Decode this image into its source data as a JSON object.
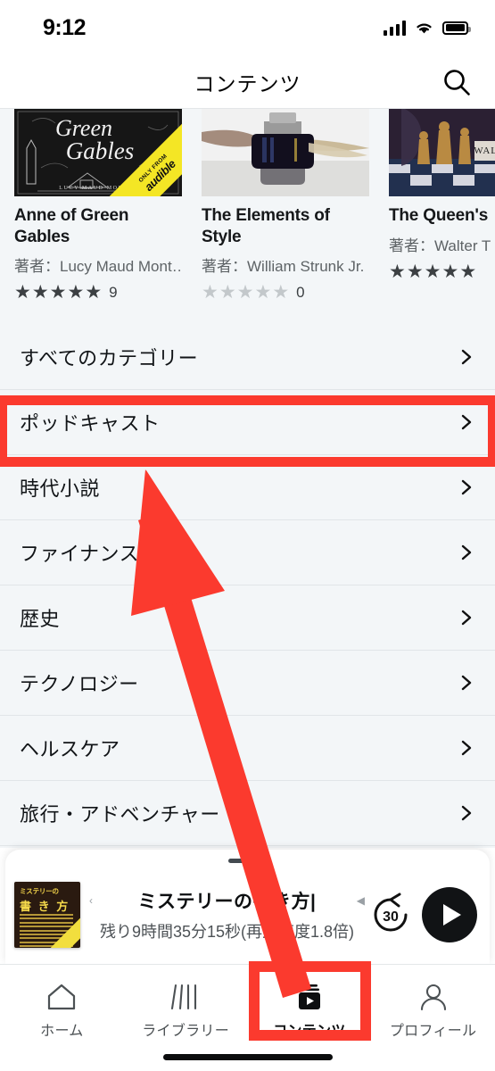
{
  "status_bar": {
    "time": "9:12",
    "icons": [
      "cellular-signal-icon",
      "wifi-icon",
      "battery-icon"
    ]
  },
  "header": {
    "title": "コンテンツ",
    "search_icon": "search-icon"
  },
  "carousel": {
    "books": [
      {
        "title": "Anne of Green Gables",
        "author": "著者：Lucy Maud Mont…",
        "rating_filled": 5,
        "rating_total": 5,
        "review_count": "9",
        "cover_text_line1": "Green",
        "cover_text_line2": "Gables",
        "cover_credit": "LUCY MAUD MONTG",
        "badge_small": "ONLY FROM",
        "badge_brand": "audible"
      },
      {
        "title": "The Elements of Style",
        "author": "著者：William Strunk Jr.",
        "rating_filled": 0,
        "rating_total": 5,
        "review_count": "0"
      },
      {
        "title": "The Queen's",
        "author": "著者：Walter T",
        "rating_filled": 5,
        "rating_total": 5,
        "review_count": "",
        "cover_text": "WALTER"
      }
    ]
  },
  "categories": [
    {
      "label": "すべてのカテゴリー",
      "chevron": "chevron-right-icon"
    },
    {
      "label": "ポッドキャスト",
      "chevron": "chevron-right-icon"
    },
    {
      "label": "時代小説",
      "chevron": "chevron-right-icon"
    },
    {
      "label": "ファイナンス",
      "chevron": "chevron-right-icon"
    },
    {
      "label": "歴史",
      "chevron": "chevron-right-icon"
    },
    {
      "label": "テクノロジー",
      "chevron": "chevron-right-icon"
    },
    {
      "label": "ヘルスケア",
      "chevron": "chevron-right-icon"
    },
    {
      "label": "旅行・アドベンチャー",
      "chevron": "chevron-right-icon"
    }
  ],
  "mini_player": {
    "title": "ミステリーの書き方|",
    "subtitle": "残り9時間35分15秒(再生速度1.8倍)",
    "marquee_left": "‹",
    "marquee_right": "◀",
    "rewind_label": "30",
    "rewind_icon": "rewind-30-icon",
    "play_icon": "play-icon",
    "grabber": "drag-handle",
    "artwork": {
      "line1": "ミステリーの",
      "line2": "書 き 方"
    }
  },
  "tab_bar": {
    "tabs": [
      {
        "label": "ホーム",
        "icon": "home-icon",
        "active": false
      },
      {
        "label": "ライブラリー",
        "icon": "library-icon",
        "active": false
      },
      {
        "label": "コンテンツ",
        "icon": "content-play-icon",
        "active": true
      },
      {
        "label": "プロフィール",
        "icon": "profile-icon",
        "active": false
      }
    ]
  },
  "annotations": {
    "highlight_color": "#fb3a2e",
    "highlighted_row": "ポッドキャスト",
    "highlighted_tab": "コンテンツ",
    "arrow": "red-arrow-pointing-up"
  }
}
